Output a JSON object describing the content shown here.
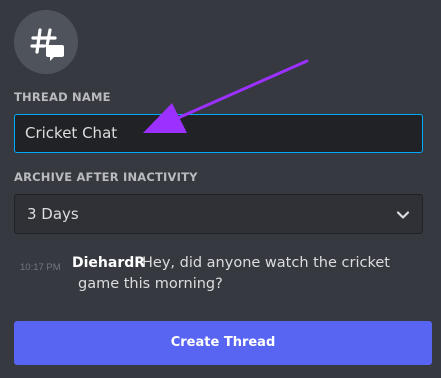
{
  "thread_icon": "thread-hashtag-icon",
  "thread_name": {
    "label": "THREAD NAME",
    "value": "Cricket Chat"
  },
  "archive": {
    "label": "ARCHIVE AFTER INACTIVITY",
    "selected": "3 Days",
    "icon": "chevron-down-icon"
  },
  "message": {
    "time": "10:17 PM",
    "author": "DiehardR",
    "text": "Hey, did anyone watch the cricket game this morning?"
  },
  "create_button": {
    "label": "Create Thread"
  },
  "colors": {
    "background": "#36393f",
    "accent": "#5865f2",
    "focus_border": "#00aafc",
    "annotation_arrow": "#9b30ff"
  }
}
